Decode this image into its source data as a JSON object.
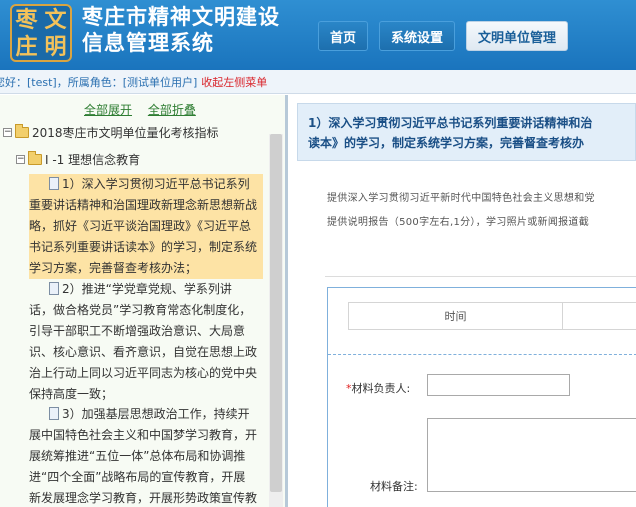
{
  "header": {
    "logo_chars": [
      "枣",
      "文",
      "庄",
      "明"
    ],
    "title_line1": "枣庄市精神文明建设",
    "title_line2": "信息管理系统",
    "nav": [
      {
        "label": "首页",
        "active": false
      },
      {
        "label": "系统设置",
        "active": false
      },
      {
        "label": "文明单位管理",
        "active": true
      }
    ]
  },
  "userbar": {
    "text": "您好：[test]，所属角色：[测试单位用户]",
    "collapse_label": "收起左侧菜单"
  },
  "tree": {
    "expand_all": "全部展开",
    "collapse_all": "全部折叠",
    "root": "2018枣庄市文明单位量化考核指标",
    "category": "I -1 理想信念教育",
    "item1_lines": [
      "1）深入学习贯彻习近平总书记系列",
      "重要讲话精神和治国理政新理念新思想新战",
      "略，抓好《习近平谈治国理政》《习近平总",
      "书记系列重要讲话读本》的学习，制定系统",
      "学习方案，完善督查考核办法；"
    ],
    "item2_lines": [
      "2）推进“学党章党规、学系列讲",
      "话，做合格党员”学习教育常态化制度化，",
      "引导干部职工不断增强政治意识、大局意",
      "识、核心意识、看齐意识，自觉在思想上政",
      "治上行动上同以习近平同志为核心的党中央",
      "保持高度一致；"
    ],
    "item3_lines": [
      "3）加强基层思想政治工作，持续开",
      "展中国特色社会主义和中国梦学习教育，开",
      "展统筹推进“五位一体”总体布局和协调推",
      "进“四个全面”战略布局的宣传教育，开展",
      "新发展理念学习教育，开展形势政策宣传教"
    ]
  },
  "content": {
    "title_line1": "1）深入学习贯彻习近平总书记系列重要讲话精神和治",
    "title_line2": "读本》的学习，制定系统学习方案，完善督查考核办",
    "desc_line1": "提供深入学习贯彻习近平新时代中国特色社会主义思想和党",
    "desc_line2": "提供说明报告（500字左右,1分），学习照片或新闻报道截",
    "time_header": "时间",
    "field_owner_label": "材料负责人:",
    "field_note_label": "材料备注:",
    "owner_value": "",
    "note_value": ""
  },
  "colors": {
    "header_blue": "#1a74bd",
    "logo_gold": "#f3c25a",
    "tree_link_green": "#2e7d32",
    "selected_bg": "#fde3a5",
    "title_blue": "#1a4f86",
    "required_red": "#e02020"
  }
}
